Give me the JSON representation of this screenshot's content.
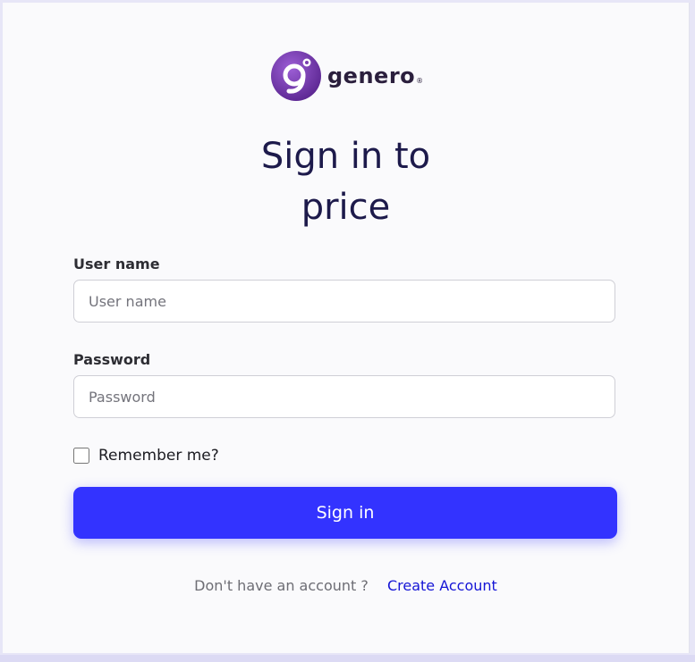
{
  "brand": {
    "name": "genero",
    "reg_mark": "®",
    "icon": "genero-logo-icon",
    "colors": {
      "logo_purple": "#7b3fb0",
      "logo_dark": "#2b1f3d"
    }
  },
  "page": {
    "title_line1": "Sign in to",
    "title_line2": "price"
  },
  "form": {
    "username": {
      "label": "User name",
      "placeholder": "User name",
      "value": ""
    },
    "password": {
      "label": "Password",
      "placeholder": "Password",
      "value": ""
    },
    "remember": {
      "label": "Remember me?",
      "checked": false
    },
    "submit_label": "Sign in"
  },
  "footer": {
    "prompt": "Don't have an account ?",
    "link_label": "Create Account"
  },
  "colors": {
    "accent": "#3333ff",
    "link": "#1515d6",
    "title": "#1d1a4b",
    "background": "#fafafc"
  }
}
